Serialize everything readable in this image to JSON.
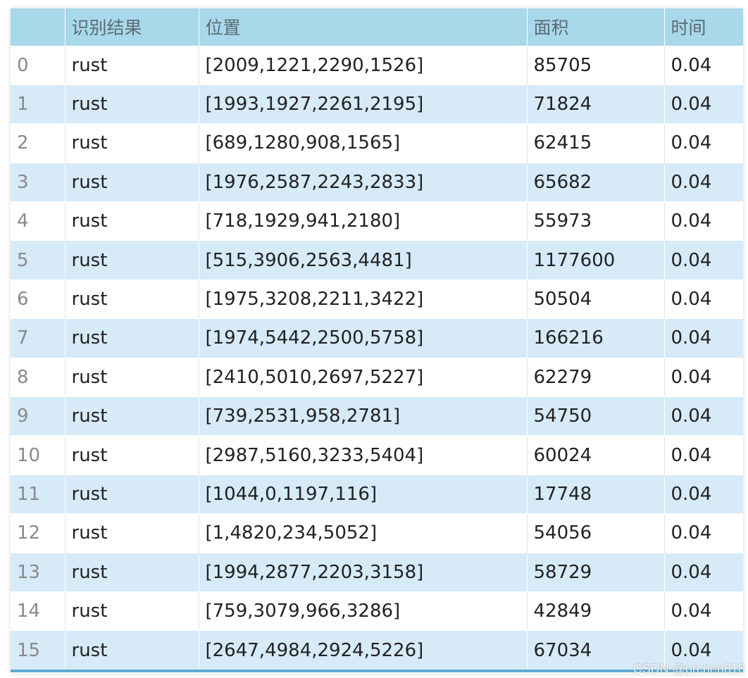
{
  "table": {
    "headers": [
      "",
      "识别结果",
      "位置",
      "面积",
      "时间"
    ],
    "rows": [
      [
        "0",
        "rust",
        "[2009,1221,2290,1526]",
        "85705",
        "0.04"
      ],
      [
        "1",
        "rust",
        "[1993,1927,2261,2195]",
        "71824",
        "0.04"
      ],
      [
        "2",
        "rust",
        "[689,1280,908,1565]",
        "62415",
        "0.04"
      ],
      [
        "3",
        "rust",
        "[1976,2587,2243,2833]",
        "65682",
        "0.04"
      ],
      [
        "4",
        "rust",
        "[718,1929,941,2180]",
        "55973",
        "0.04"
      ],
      [
        "5",
        "rust",
        "[515,3906,2563,4481]",
        "1177600",
        "0.04"
      ],
      [
        "6",
        "rust",
        "[1975,3208,2211,3422]",
        "50504",
        "0.04"
      ],
      [
        "7",
        "rust",
        "[1974,5442,2500,5758]",
        "166216",
        "0.04"
      ],
      [
        "8",
        "rust",
        "[2410,5010,2697,5227]",
        "62279",
        "0.04"
      ],
      [
        "9",
        "rust",
        "[739,2531,958,2781]",
        "54750",
        "0.04"
      ],
      [
        "10",
        "rust",
        "[2987,5160,3233,5404]",
        "60024",
        "0.04"
      ],
      [
        "11",
        "rust",
        "[1044,0,1197,116]",
        "17748",
        "0.04"
      ],
      [
        "12",
        "rust",
        "[1,4820,234,5052]",
        "54056",
        "0.04"
      ],
      [
        "13",
        "rust",
        "[1994,2877,2203,3158]",
        "58729",
        "0.04"
      ],
      [
        "14",
        "rust",
        "[759,3079,966,3286]",
        "42849",
        "0.04"
      ],
      [
        "15",
        "rust",
        "[2647,4984,2924,5226]",
        "67034",
        "0.04"
      ]
    ]
  },
  "watermark": "CSDN @prchen818",
  "colors": {
    "header_bg": "#a8d8ea",
    "row_even_bg": "#d6eaf8",
    "row_odd_bg": "#ffffff",
    "bottom_bar": "#5fa9d3"
  }
}
